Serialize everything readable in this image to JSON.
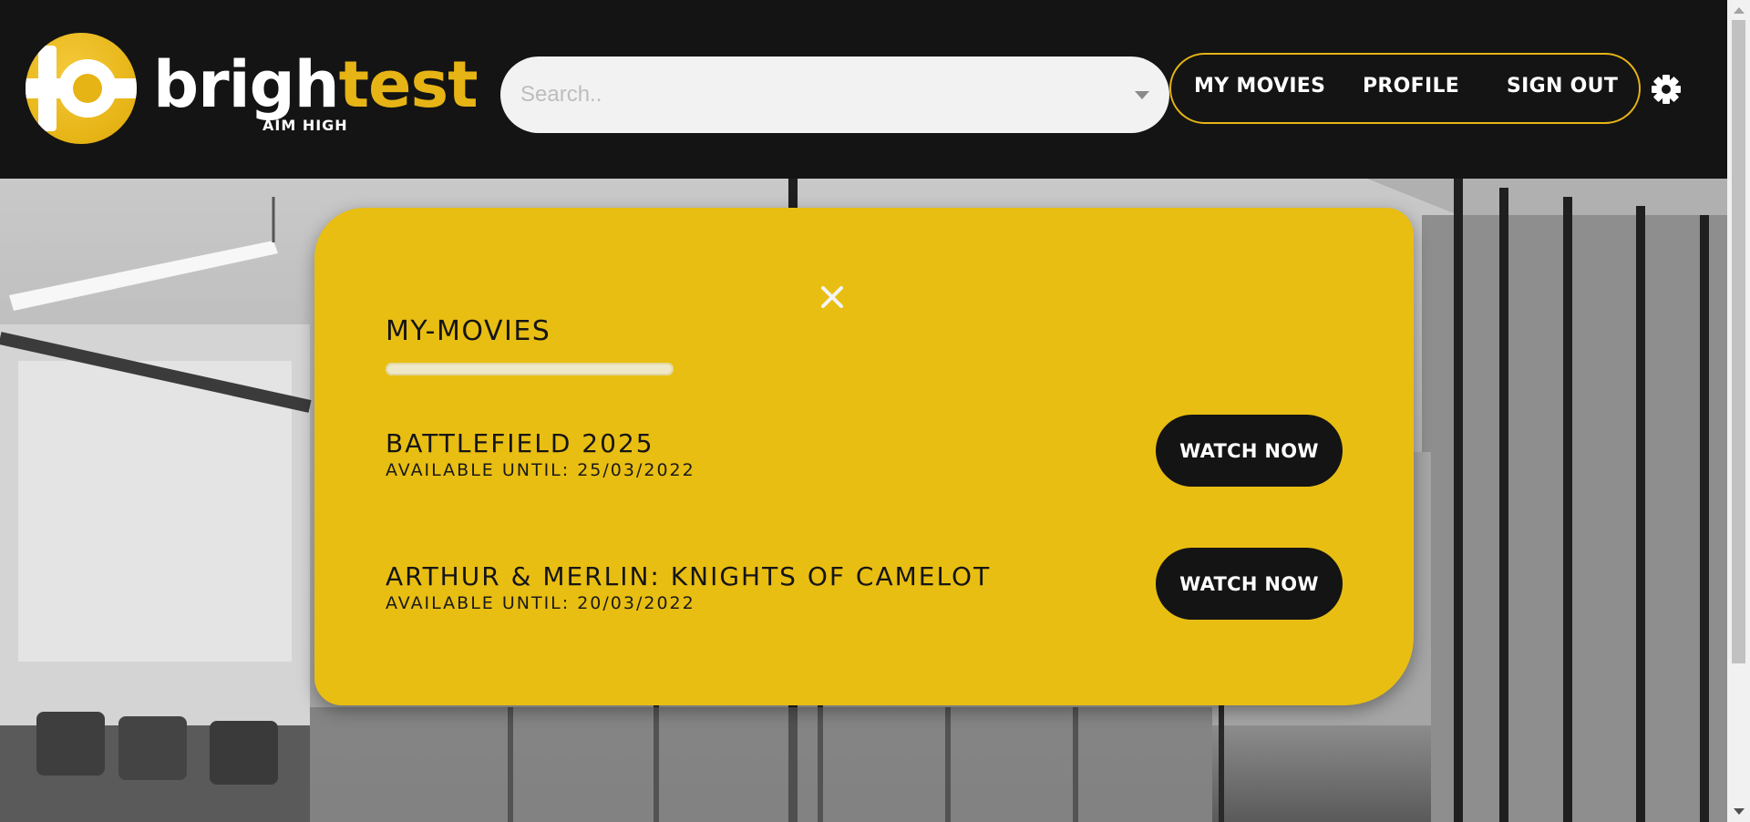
{
  "header": {
    "logo": {
      "word_part1": "brigh",
      "word_part2": "test",
      "tagline": "AIM HIGH"
    },
    "search": {
      "placeholder": "Search.."
    },
    "nav": {
      "my_movies": "MY MOVIES",
      "profile": "PROFILE",
      "sign_out": "SIGN OUT"
    },
    "settings_icon": "gear-icon"
  },
  "modal": {
    "title": "MY-MOVIES",
    "close_label": "X",
    "movies": [
      {
        "title": "BATTLEFIELD 2025",
        "availability": "AVAILABLE UNTIL: 25/03/2022",
        "button": "WATCH NOW"
      },
      {
        "title": "ARTHUR & MERLIN: KNIGHTS OF CAMELOT",
        "availability": "AVAILABLE UNTIL: 20/03/2022",
        "button": "WATCH NOW"
      }
    ]
  },
  "colors": {
    "brand_yellow": "#e9be12",
    "header_bg": "#141414",
    "button_dark": "#141414"
  }
}
